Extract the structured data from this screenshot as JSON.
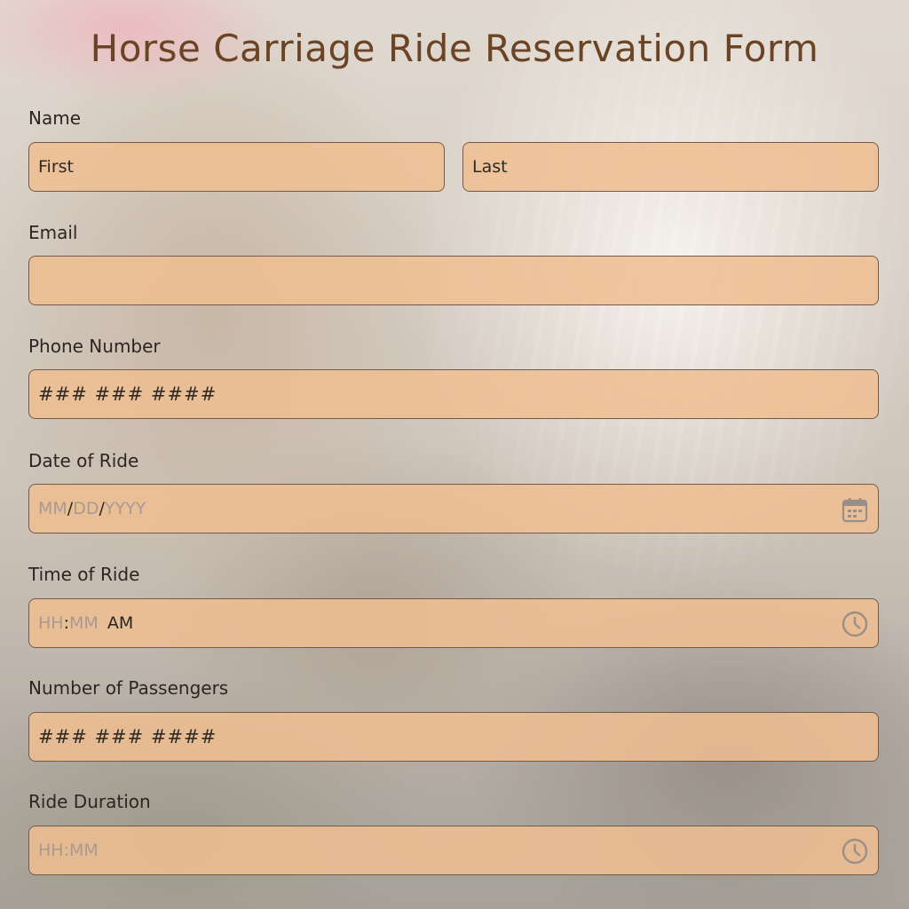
{
  "title": "Horse Carriage Ride Reservation Form",
  "name": {
    "label": "Name",
    "first_placeholder": "First",
    "last_placeholder": "Last"
  },
  "email": {
    "label": "Email",
    "value": ""
  },
  "phone": {
    "label": "Phone Number",
    "placeholder": "### ### ####"
  },
  "date": {
    "label": "Date of Ride",
    "mm": "MM",
    "sep1": "/",
    "dd": "DD",
    "sep2": "/",
    "yyyy": "YYYY",
    "icon": "calendar-icon"
  },
  "time": {
    "label": "Time of Ride",
    "hh": "HH",
    "colon": ":",
    "mm": "MM",
    "ampm": "AM",
    "icon": "clock-icon"
  },
  "passengers": {
    "label": "Number of Passengers",
    "placeholder": "### ### ####"
  },
  "duration": {
    "label": "Ride Duration",
    "hh": "HH",
    "colon": ":",
    "mm": "MM",
    "icon": "clock-icon"
  },
  "colors": {
    "title": "#6b4426",
    "field_bg": "#f0be91",
    "field_border": "#6f5b4b",
    "hint": "#a99a90"
  }
}
